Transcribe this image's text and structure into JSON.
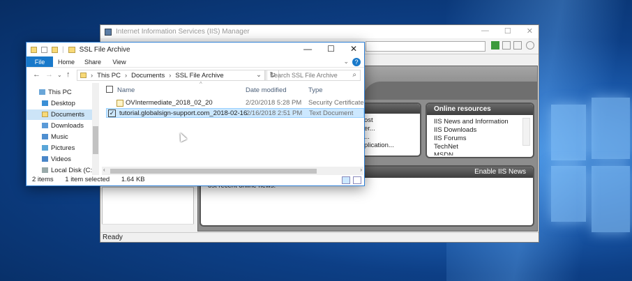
{
  "iis": {
    "title": "Internet Information Services (IIS) Manager",
    "status": "Ready",
    "connection_tasks_items": [
      "ost",
      "er...",
      "...",
      "plication..."
    ],
    "online_resources": {
      "title": "Online resources",
      "links": [
        "IIS News and Information",
        "IIS Downloads",
        "IIS Forums",
        "TechNet",
        "MSDN"
      ]
    },
    "news": {
      "enable_label": "Enable IIS News",
      "text": "ost recent online news."
    }
  },
  "explorer": {
    "title": "SSL File Archive",
    "ribbon_tabs": [
      "File",
      "Home",
      "Share",
      "View"
    ],
    "breadcrumb": [
      "This PC",
      "Documents",
      "SSL File Archive"
    ],
    "search_placeholder": "Search SSL File Archive",
    "nav_items": [
      "This PC",
      "Desktop",
      "Documents",
      "Downloads",
      "Music",
      "Pictures",
      "Videos",
      "Local Disk (C:)"
    ],
    "columns": {
      "name": "Name",
      "date": "Date modified",
      "type": "Type"
    },
    "files": [
      {
        "name": "OVIntermediate_2018_02_20",
        "date": "2/20/2018 5:28 PM",
        "type": "Security Certificate"
      },
      {
        "name": "tutorial.globalsign-support.com_2018-02-16",
        "date": "2/16/2018 2:51 PM",
        "type": "Text Document"
      }
    ],
    "status": {
      "items": "2 items",
      "selected": "1 item selected",
      "size": "1.64 KB"
    }
  },
  "colors": {
    "accent": "#1979ca",
    "selection": "#cce8ff",
    "desktop": "#0d3f86"
  }
}
